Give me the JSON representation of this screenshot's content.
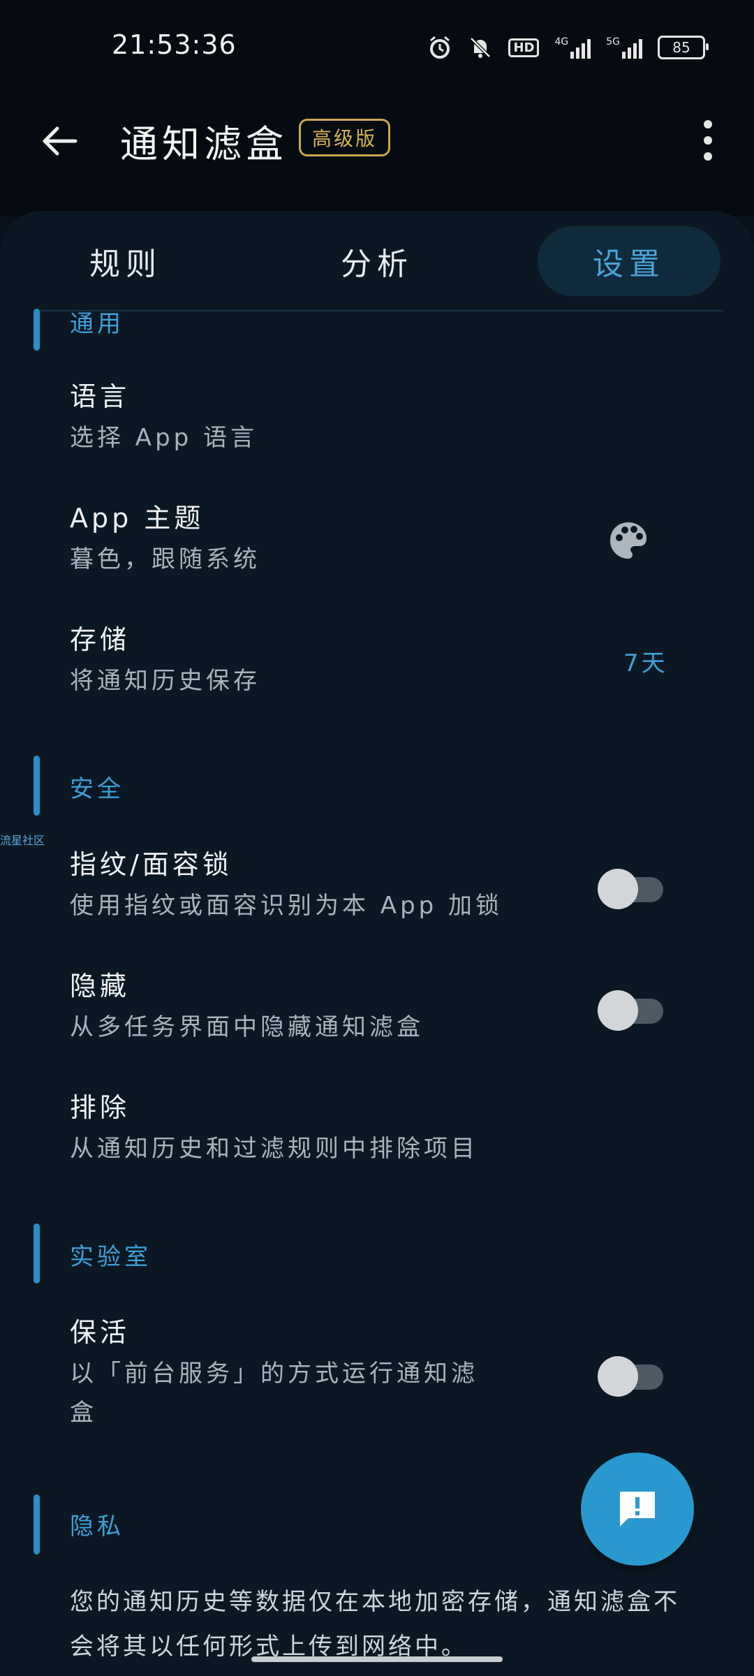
{
  "status_bar": {
    "time": "21:53:36",
    "battery": "85",
    "icons": [
      "alarm-icon",
      "bell-off-icon",
      "hd-icon",
      "signal-4g-icon",
      "signal-5g-icon",
      "battery-icon"
    ],
    "hd_label": "HD",
    "net1": "4G",
    "net2": "5G"
  },
  "app_bar": {
    "title": "通知滤盒",
    "badge": "高级版"
  },
  "tabs": [
    {
      "label": "规则",
      "active": false
    },
    {
      "label": "分析",
      "active": false
    },
    {
      "label": "设置",
      "active": true
    }
  ],
  "sections": {
    "general": {
      "title": "通用",
      "items": [
        {
          "title": "语言",
          "subtitle": "选择 App 语言"
        },
        {
          "title": "App 主题",
          "subtitle": "暮色，跟随系统",
          "icon": "palette-icon"
        },
        {
          "title": "存储",
          "subtitle": "将通知历史保存",
          "value": "7天"
        }
      ]
    },
    "security": {
      "title": "安全",
      "items": [
        {
          "title": "指纹/面容锁",
          "subtitle": "使用指纹或面容识别为本 App 加锁",
          "toggle": false
        },
        {
          "title": "隐藏",
          "subtitle": "从多任务界面中隐藏通知滤盒",
          "toggle": false
        },
        {
          "title": "排除",
          "subtitle": "从通知历史和过滤规则中排除项目"
        }
      ]
    },
    "lab": {
      "title": "实验室",
      "items": [
        {
          "title": "保活",
          "subtitle_line1": "以「前台服务」的方式运行通知滤",
          "subtitle_line2": "盒",
          "toggle": false
        }
      ]
    },
    "privacy": {
      "title": "隐私",
      "text": "您的通知历史等数据仅在本地加密存储，通知滤盒不会将其以任何形式上传到网络中。"
    }
  },
  "watermark": "流星社区",
  "colors": {
    "accent": "#3d9fd8",
    "badge_gold": "#d8b653",
    "background": "#0b1823",
    "fab": "#2898cf"
  }
}
